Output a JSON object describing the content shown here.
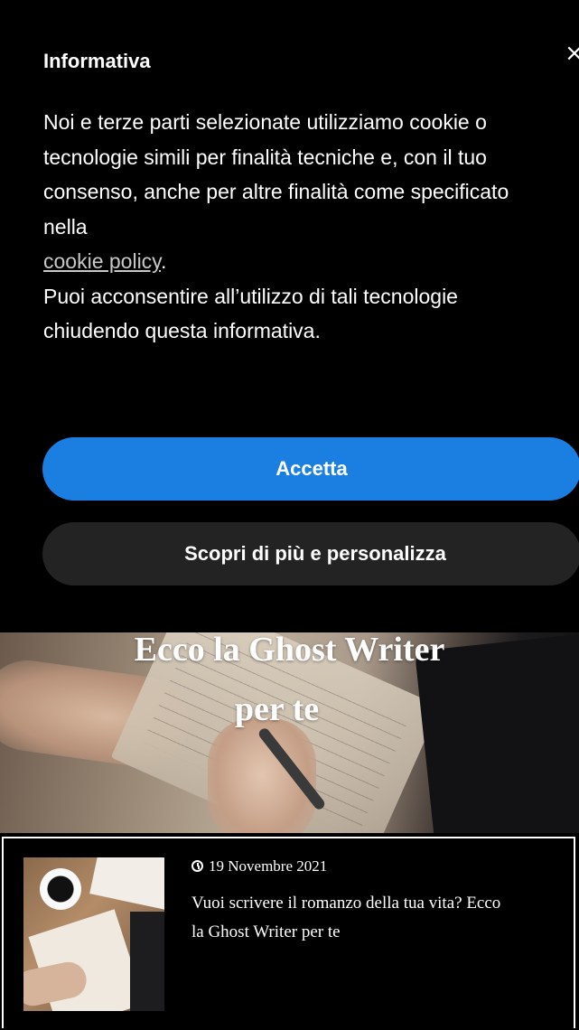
{
  "cookie_banner": {
    "title": "Informativa",
    "close_symbol": "×",
    "text_part1": "Noi e terze parti selezionate utilizziamo cookie o tecnologie simili per finalità tecniche e, con il tuo consenso, anche per altre finalità come specificato nella",
    "link_label": "cookie policy",
    "text_part2": ".",
    "text_part3": "Puoi acconsentire all’utilizzo di tali tecnologie chiudendo questa informativa.",
    "accept_label": "Accetta",
    "learn_more_label": "Scopri di più e personalizza",
    "accent_color": "#1a7fe0"
  },
  "hero": {
    "title_line1": "Ecco la Ghost Writer",
    "title_line2": "per te"
  },
  "post": {
    "date": "19 Novembre 2021",
    "date_icon": "clock-icon",
    "title": "Vuoi scrivere il romanzo della tua vita? Ecco la Ghost Writer per te"
  }
}
